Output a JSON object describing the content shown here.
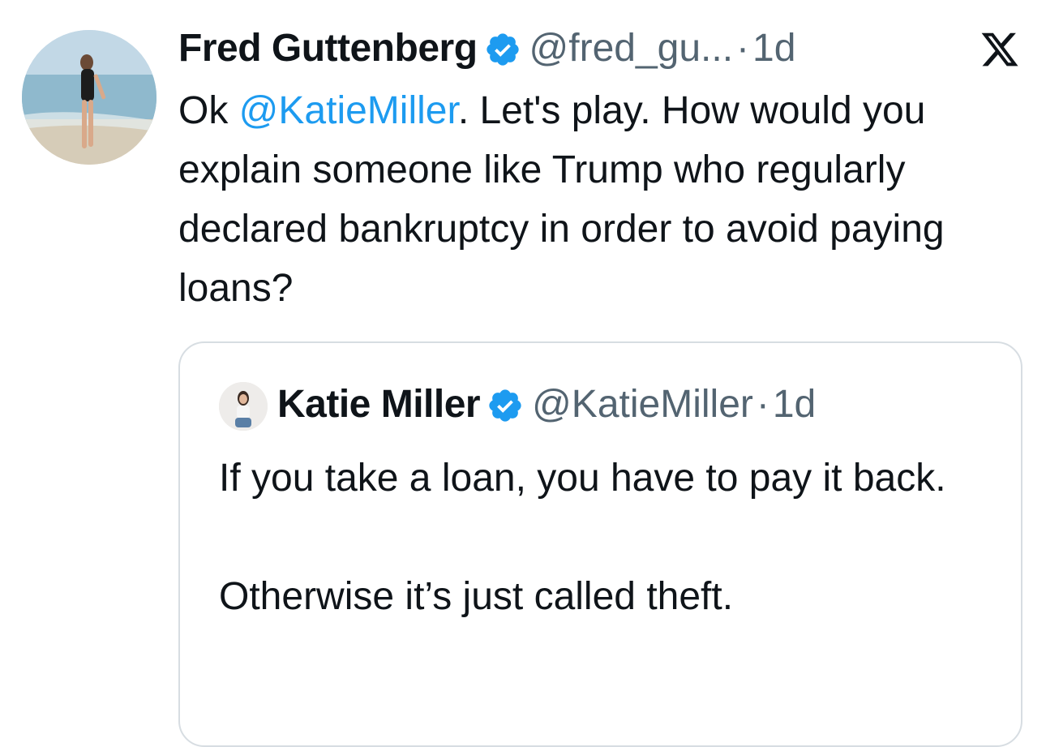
{
  "author": {
    "name": "Fred Guttenberg",
    "handle": "@fred_gu...",
    "separator": "·",
    "time": "1d"
  },
  "icons": {
    "verified": "verified-badge-icon",
    "logo": "x-logo-icon"
  },
  "colors": {
    "mention": "#1d9bf0",
    "verified": "#1d9bf0",
    "muted": "#536471",
    "text": "#0f1419"
  },
  "tweet": {
    "prefix": "Ok ",
    "mention": "@KatieMiller",
    "rest": ".  Let's play.  How would you explain someone like Trump who regularly declared bankruptcy in order to avoid paying loans?"
  },
  "quoted": {
    "name": "Katie Miller",
    "handle": "@KatieMiller",
    "separator": "·",
    "time": "1d",
    "line1": "If you take a loan, you have to pay it back.",
    "line2": "Otherwise it’s just called theft."
  }
}
